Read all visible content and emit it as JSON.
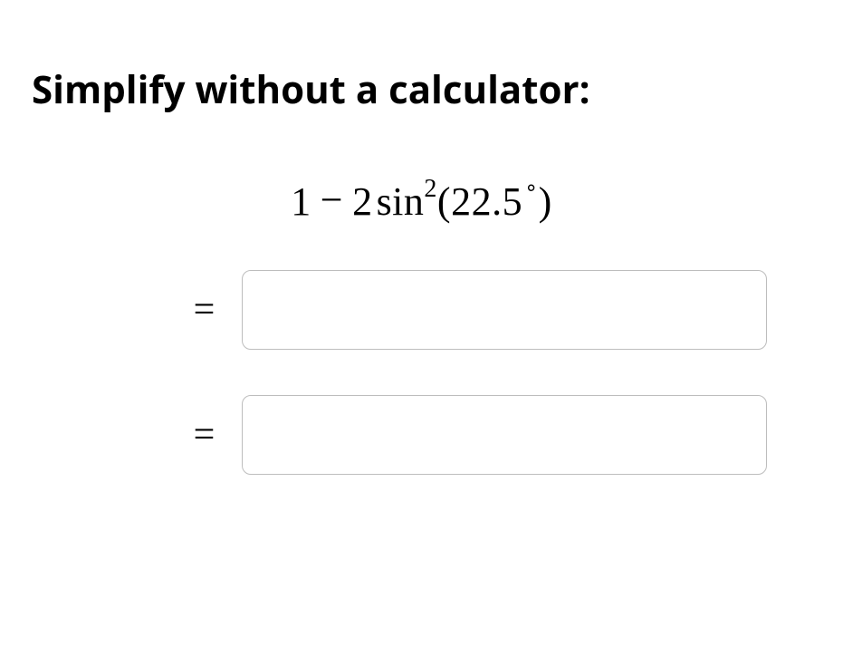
{
  "heading": "Simplify without a calculator:",
  "expression": {
    "leading": "1",
    "minus": "−",
    "coeff": "2",
    "func": "sin",
    "exp": "2",
    "open": "(",
    "angle": "22.5",
    "degree": "∘",
    "close": ")"
  },
  "equals": "=",
  "answers": [
    {
      "value": ""
    },
    {
      "value": ""
    }
  ]
}
